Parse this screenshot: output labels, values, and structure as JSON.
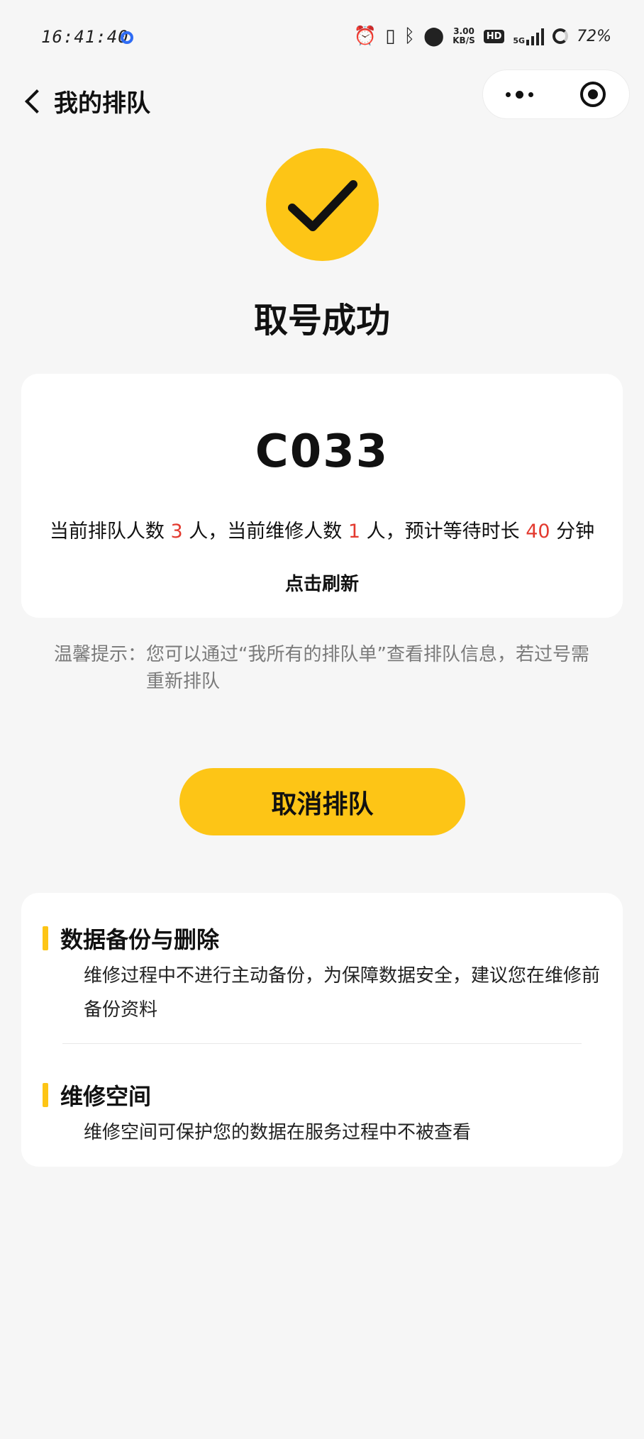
{
  "status_bar": {
    "time": "16:41:40",
    "network_speed_value": "3.00",
    "network_speed_unit": "KB/S",
    "hd_label": "HD",
    "network_type": "5G",
    "battery": "72%"
  },
  "nav": {
    "title": "我的排队"
  },
  "success": {
    "title": "取号成功",
    "accent_color": "#fdc516"
  },
  "ticket": {
    "number": "C033",
    "queue_prefix": "当前排队人数",
    "queue_count": "3",
    "queue_suffix": "人，当前维修人数",
    "repair_count": "1",
    "repair_suffix": "人，预计等待时长",
    "wait_minutes": "40",
    "wait_unit": "分钟",
    "highlight_color": "#e33a2f",
    "refresh_label": "点击刷新"
  },
  "tip": {
    "label": "温馨提示：",
    "text": "您可以通过“我所有的排队单”查看排队信息，若过号需重新排队"
  },
  "cancel_button": {
    "label": "取消排队"
  },
  "info": {
    "sections": [
      {
        "heading": "数据备份与删除",
        "body": "维修过程中不进行主动备份，为保障数据安全，建议您在维修前备份资料"
      },
      {
        "heading": "维修空间",
        "body": "维修空间可保护您的数据在服务过程中不被查看"
      }
    ]
  }
}
